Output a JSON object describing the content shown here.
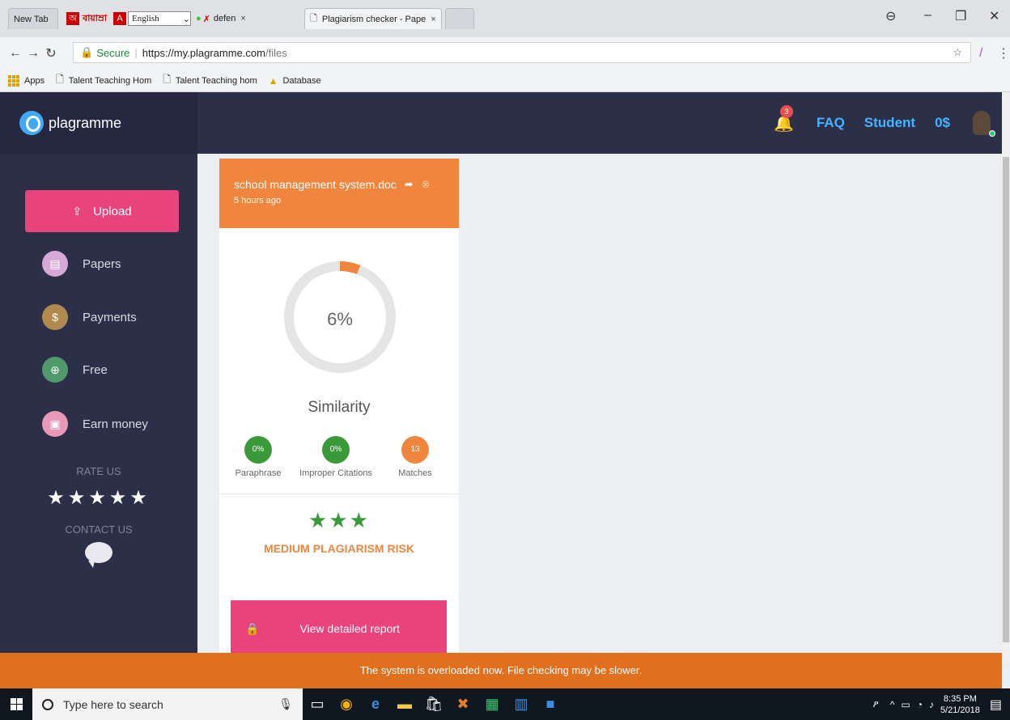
{
  "browser": {
    "tabs": [
      {
        "label": "New Tab"
      },
      {
        "label": "বায়াম্রা",
        "lang": "English"
      },
      {
        "label": "defen"
      },
      {
        "label": "Plagiarism checker - Pape"
      }
    ],
    "secure_label": "Secure",
    "url_host": "https://my.plagramme.com",
    "url_path": "/files",
    "bookmarks": [
      {
        "label": "Apps"
      },
      {
        "label": "Talent Teaching Hom"
      },
      {
        "label": "Talent Teaching hom"
      },
      {
        "label": "Database"
      }
    ]
  },
  "header": {
    "logo": "plagramme",
    "notification_count": "3",
    "faq": "FAQ",
    "student": "Student",
    "balance": "0$"
  },
  "sidebar": {
    "upload": "Upload",
    "items": [
      {
        "label": "Papers",
        "color": "#d8a9d8"
      },
      {
        "label": "Payments",
        "color": "#b0894e"
      },
      {
        "label": "Free",
        "color": "#4e9a6a"
      },
      {
        "label": "Earn money",
        "color": "#e89ab8"
      }
    ],
    "rate_us": "RATE US",
    "rate_stars": "★★★★★",
    "contact_us": "CONTACT US"
  },
  "card": {
    "filename": "school management system.doc",
    "time": "5 hours ago",
    "similarity_pct": "6%",
    "similarity_value": 6,
    "similarity_label": "Similarity",
    "metrics": [
      {
        "value": "0%",
        "label": "Paraphrase",
        "color": "#3a9a3a"
      },
      {
        "value": "0%",
        "label": "Improper Citations",
        "color": "#3a9a3a"
      },
      {
        "value": "13",
        "label": "Matches",
        "color": "#f0853e"
      }
    ],
    "risk_stars": "★★★",
    "risk_label": "MEDIUM PLAGIARISM RISK",
    "report_button": "View detailed report"
  },
  "banner": "The system is overloaded now. File checking may be slower.",
  "taskbar": {
    "search_placeholder": "Type here to search",
    "time": "8:35 PM",
    "date": "5/21/2018"
  },
  "colors": {
    "accent_pink": "#e8437b",
    "accent_orange": "#f0853e",
    "sidebar_bg": "#2c2f48",
    "link_blue": "#46b3ff"
  }
}
